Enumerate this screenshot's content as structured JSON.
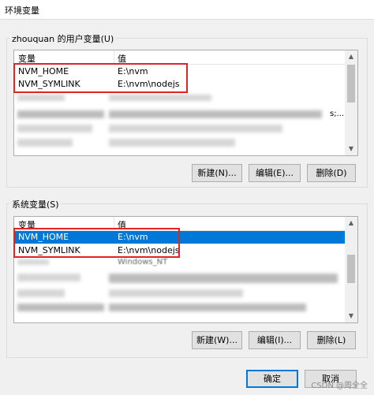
{
  "window": {
    "title": "环境变量"
  },
  "user_vars": {
    "group_label": "zhouquan 的用户变量(U)",
    "col_variable": "变量",
    "col_value": "值",
    "rows": [
      {
        "name": "NVM_HOME",
        "value": "E:\\nvm"
      },
      {
        "name": "NVM_SYMLINK",
        "value": "E:\\nvm\\nodejs"
      }
    ],
    "partial_value_tail": "s;...",
    "buttons": {
      "new": "新建(N)...",
      "edit": "编辑(E)...",
      "delete": "删除(D)"
    }
  },
  "system_vars": {
    "group_label": "系统变量(S)",
    "col_variable": "变量",
    "col_value": "值",
    "rows": [
      {
        "name": "NVM_HOME",
        "value": "E:\\nvm",
        "selected": true
      },
      {
        "name": "NVM_SYMLINK",
        "value": "E:\\nvm\\nodejs",
        "selected": false
      }
    ],
    "partial_row_value": "Windows_NT",
    "buttons": {
      "new": "新建(W)...",
      "edit": "编辑(I)...",
      "delete": "删除(L)"
    }
  },
  "dialog_buttons": {
    "ok": "确定",
    "cancel": "取消"
  },
  "watermark": "CSDN @周全全",
  "colors": {
    "selection": "#0078d7",
    "highlight_box": "#e02424"
  },
  "icons": {
    "scroll_up": "▲",
    "scroll_down": "▼"
  }
}
